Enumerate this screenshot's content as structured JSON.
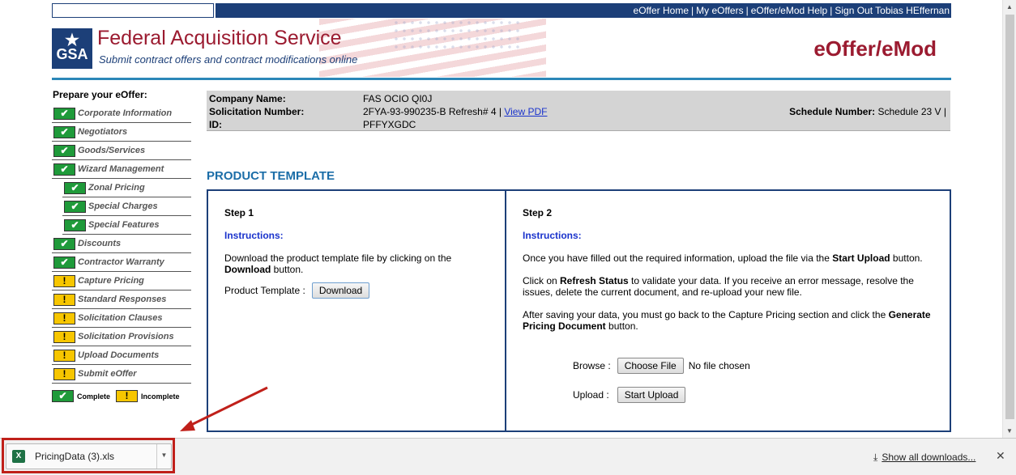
{
  "top_nav": {
    "links": [
      "eOffer Home",
      "My eOffers",
      "eOffer/eMod Help",
      "Sign Out Tobias HEffernan"
    ],
    "separator": "|"
  },
  "banner": {
    "logo_text": "GSA",
    "title": "Federal Acquisition Service",
    "subtitle": "Submit contract offers and contract modifications online",
    "app_title": "eOffer/eMod"
  },
  "sidebar": {
    "heading": "Prepare your eOffer:",
    "items": [
      {
        "label": "Corporate Information",
        "status": "complete",
        "indent": false
      },
      {
        "label": "Negotiators",
        "status": "complete",
        "indent": false
      },
      {
        "label": "Goods/Services",
        "status": "complete",
        "indent": false
      },
      {
        "label": "Wizard Management",
        "status": "complete",
        "indent": false
      },
      {
        "label": "Zonal Pricing",
        "status": "complete",
        "indent": true
      },
      {
        "label": "Special Charges",
        "status": "complete",
        "indent": true
      },
      {
        "label": "Special Features",
        "status": "complete",
        "indent": true
      },
      {
        "label": "Discounts",
        "status": "complete",
        "indent": false
      },
      {
        "label": "Contractor Warranty",
        "status": "complete",
        "indent": false
      },
      {
        "label": "Capture Pricing",
        "status": "incomplete",
        "indent": false
      },
      {
        "label": "Standard Responses",
        "status": "incomplete",
        "indent": false
      },
      {
        "label": "Solicitation Clauses",
        "status": "incomplete",
        "indent": false
      },
      {
        "label": "Solicitation Provisions",
        "status": "incomplete",
        "indent": false
      },
      {
        "label": "Upload Documents",
        "status": "incomplete",
        "indent": false
      },
      {
        "label": "Submit eOffer",
        "status": "incomplete",
        "indent": false
      }
    ],
    "legend": {
      "complete": "Complete",
      "incomplete": "Incomplete"
    },
    "icons": {
      "complete": "✔",
      "incomplete": "!"
    }
  },
  "company": {
    "company_name_label": "Company Name:",
    "company_name": "FAS OCIO QI0J",
    "solicitation_label": "Solicitation Number:",
    "solicitation_value": "2FYA-93-990235-B Refresh# 4 |",
    "view_pdf": "View PDF",
    "id_label": "ID:",
    "id_value": "PFFYXGDC",
    "schedule_label": "Schedule Number:",
    "schedule_value": "Schedule 23 V |"
  },
  "product_template": {
    "title": "PRODUCT TEMPLATE",
    "step1": {
      "title": "Step 1",
      "instructions_label": "Instructions:",
      "text_pre": "Download the product template file by clicking on the ",
      "text_bold": "Download",
      "text_post": " button.",
      "field_label": "Product Template :",
      "button": "Download"
    },
    "step2": {
      "title": "Step 2",
      "instructions_label": "Instructions:",
      "p1_pre": "Once you have filled out the required information, upload the file via the ",
      "p1_bold": "Start Upload",
      "p1_post": " button.",
      "p2_pre": "Click on ",
      "p2_bold": "Refresh Status",
      "p2_post": " to validate your data. If you receive an error message, resolve the issues, delete the current document, and re-upload your new file.",
      "p3_pre": "After saving your data, you must go back to the Capture Pricing section and click the ",
      "p3_bold": "Generate Pricing Document",
      "p3_post": " button.",
      "browse_label": "Browse :",
      "choose_file": "Choose File",
      "no_file": "No file chosen",
      "upload_label": "Upload :",
      "start_upload": "Start Upload"
    }
  },
  "downloads_bar": {
    "file_name": "PricingData (3).xls",
    "show_all": "Show all downloads...",
    "close": "✕",
    "file_icon_text": "X",
    "chevron": "▼"
  },
  "colors": {
    "nav_blue": "#1c3f78",
    "banner_red": "#9b1b30",
    "complete_green": "#1f9a3a",
    "incomplete_yellow": "#f7c600",
    "link_blue": "#1a33cc",
    "annotation_red": "#c0201a"
  }
}
